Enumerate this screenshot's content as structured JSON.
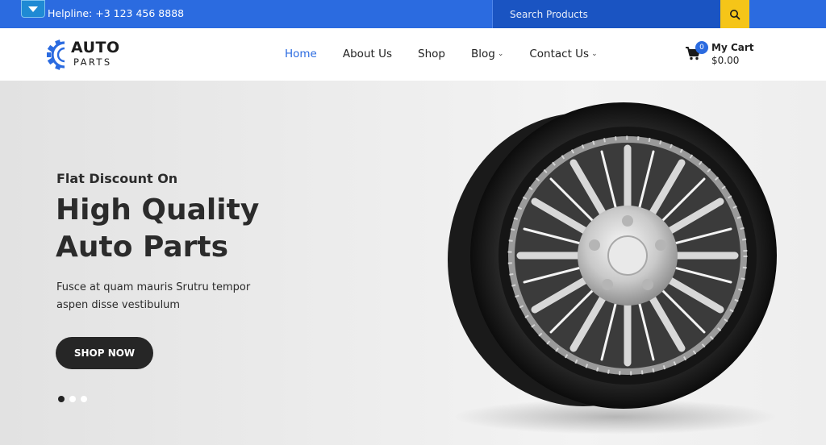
{
  "topbar": {
    "helpline": "Helpline: +3 123 456 8888",
    "search_placeholder": "Search Products",
    "colors": {
      "bar": "#2b6be0",
      "search_button": "#f5c518"
    },
    "icons": {
      "toggle": "chevron-down-icon",
      "search": "search-icon"
    }
  },
  "logo": {
    "line1": "AUTO",
    "line2": "PARTS",
    "icon": "gear-icon"
  },
  "nav": {
    "items": [
      {
        "label": "Home",
        "active": true,
        "dropdown": false
      },
      {
        "label": "About Us",
        "active": false,
        "dropdown": false
      },
      {
        "label": "Shop",
        "active": false,
        "dropdown": false
      },
      {
        "label": "Blog",
        "active": false,
        "dropdown": true
      },
      {
        "label": "Contact Us",
        "active": false,
        "dropdown": true
      }
    ]
  },
  "cart": {
    "count": "0",
    "label": "My Cart",
    "total": "$0.00",
    "icon": "cart-icon"
  },
  "hero": {
    "subtitle": "Flat Discount On",
    "headline_line1": "High Quality",
    "headline_line2": "Auto Parts",
    "description": "Fusce at quam mauris Srutru tempor aspen disse vestibulum",
    "button_label": "SHOP NOW",
    "image": "alloy-wheel-image",
    "slides": {
      "count": 3,
      "active_index": 0
    }
  }
}
